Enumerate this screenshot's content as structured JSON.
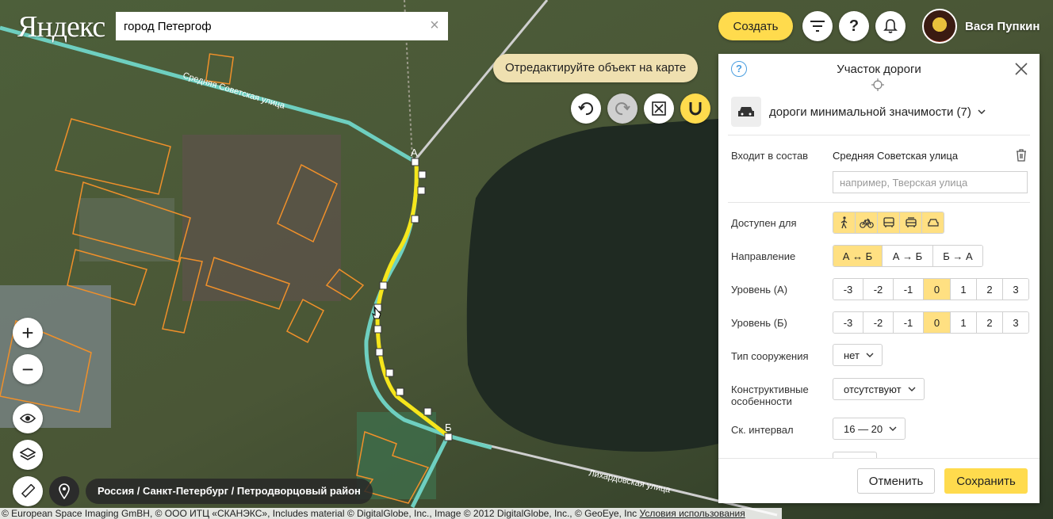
{
  "header": {
    "logo": "Яндекс",
    "search_value": "город Петергоф",
    "create_label": "Создать",
    "user_name": "Вася Пупкин"
  },
  "map": {
    "hint": "Отредактируйте объект на карте",
    "streets": [
      "Средняя Советская улица",
      "Лихардовская улица"
    ],
    "point_a": "А",
    "point_b": "Б",
    "breadcrumb": "Россия / Санкт-Петербург / Петродворцовый район",
    "copyright": "© European Space Imaging GmBH, © ООО ИТЦ «СКАНЭКС», Includes material © DigitalGlobe, Inc., Image © 2012 DigitalGlobe, Inc., © GeoEye, Inc",
    "terms_link": "Условия использования",
    "colors": {
      "road": "#6ecfc0",
      "edited_segment": "#f5e61c",
      "buildings": "#f0902a"
    }
  },
  "panel": {
    "title": "Участок дороги",
    "road_type": "дороги минимальной значимости (7)",
    "member_label": "Входит в состав",
    "member_value": "Средняя Советская улица",
    "member_placeholder": "например, Тверская улица",
    "access_label": "Доступен для",
    "access_icons": [
      "pedestrian-icon",
      "bicycle-icon",
      "bus-icon",
      "trolleybus-icon",
      "car-icon"
    ],
    "direction_label": "Направление",
    "direction_options": [
      "А ↔ Б",
      "А → Б",
      "Б → А"
    ],
    "direction_selected": 0,
    "level_a_label": "Уровень (А)",
    "level_b_label": "Уровень (Б)",
    "level_options": [
      "-3",
      "-2",
      "-1",
      "0",
      "1",
      "2",
      "3"
    ],
    "level_a_selected": 3,
    "level_b_selected": 3,
    "structure_label": "Тип сооружения",
    "structure_value": "нет",
    "features_label": "Конструктивные особенности",
    "features_value": "отсутствуют",
    "speed_label": "Ск. интервал",
    "speed_value": "16 — 20",
    "cancel_label": "Отменить",
    "save_label": "Сохранить"
  }
}
